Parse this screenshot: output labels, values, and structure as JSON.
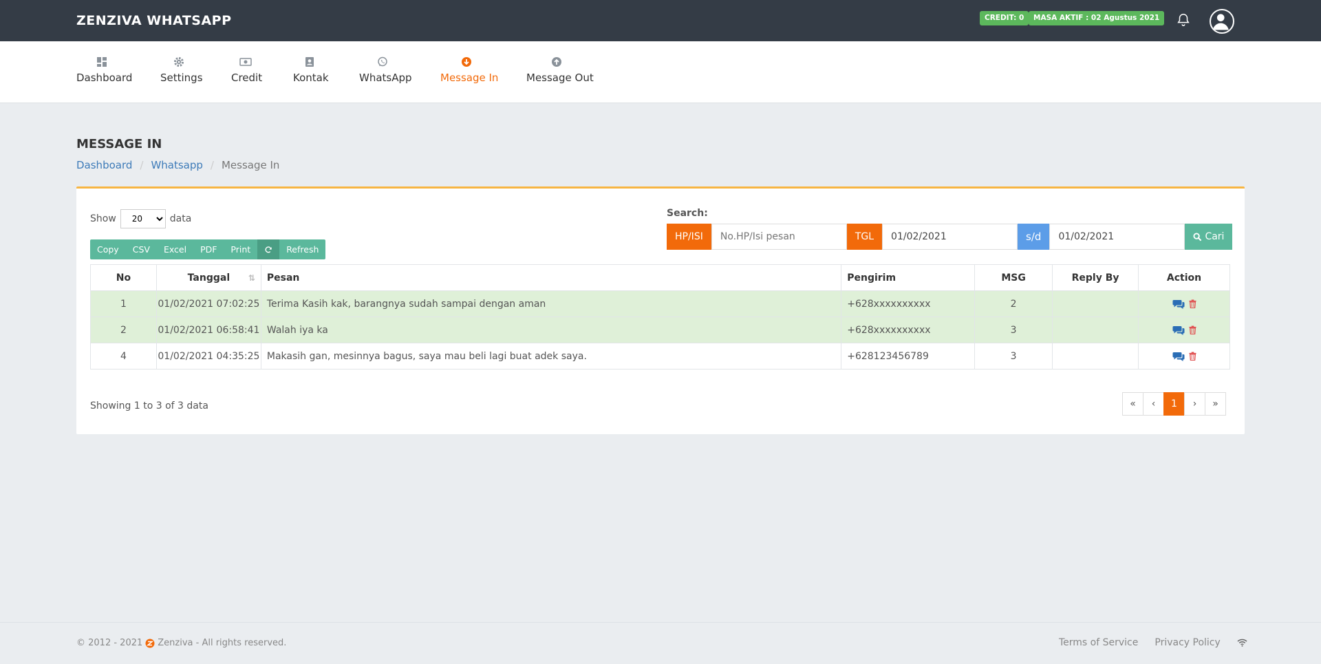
{
  "app": {
    "brand": "ZENZIVA WHATSAPP",
    "credit_badge": "CREDIT: 0",
    "masa_badge": "MASA AKTIF : 02 Agustus 2021"
  },
  "nav": [
    {
      "label": "Dashboard",
      "icon": "dashboard-icon"
    },
    {
      "label": "Settings",
      "icon": "gear-icon"
    },
    {
      "label": "Credit",
      "icon": "money-icon"
    },
    {
      "label": "Kontak",
      "icon": "contact-icon"
    },
    {
      "label": "WhatsApp",
      "icon": "whatsapp-icon"
    },
    {
      "label": "Message In",
      "icon": "arrow-circle-down-icon",
      "active": true
    },
    {
      "label": "Message Out",
      "icon": "arrow-circle-up-icon"
    }
  ],
  "page": {
    "title": "MESSAGE IN",
    "breadcrumb": [
      "Dashboard",
      "Whatsapp",
      "Message In"
    ]
  },
  "controls": {
    "show_label": "Show",
    "show_value": "20",
    "show_suffix": "data",
    "buttons": [
      "Copy",
      "CSV",
      "Excel",
      "PDF",
      "Print"
    ],
    "refresh_label": "Refresh",
    "search_label": "Search:",
    "hp_addon": "HP/ISI",
    "hp_placeholder": "No.HP/Isi pesan",
    "tgl_addon": "TGL",
    "date_from": "01/02/2021",
    "sd_addon": "s/d",
    "date_to": "01/02/2021",
    "cari_label": "Cari"
  },
  "table": {
    "headers": [
      "No",
      "Tanggal",
      "Pesan",
      "Pengirim",
      "MSG",
      "Reply By",
      "Action"
    ],
    "rows": [
      {
        "no": "1",
        "tanggal": "01/02/2021 07:02:25",
        "pesan": "Terima Kasih kak, barangnya sudah sampai dengan aman",
        "pengirim": "+628xxxxxxxxxx",
        "msg": "2",
        "reply_by": ""
      },
      {
        "no": "2",
        "tanggal": "01/02/2021 06:58:41",
        "pesan": "Walah iya ka",
        "pengirim": "+628xxxxxxxxxx",
        "msg": "3",
        "reply_by": ""
      },
      {
        "no": "4",
        "tanggal": "01/02/2021 04:35:25",
        "pesan": "Makasih gan, mesinnya bagus, saya mau beli lagi buat adek saya.",
        "pengirim": "+628123456789",
        "msg": "3",
        "reply_by": ""
      }
    ],
    "info": "Showing 1 to 3 of 3 data"
  },
  "pager": [
    "«",
    "‹",
    "1",
    "›",
    "»"
  ],
  "footer": {
    "copyright": "© 2012 - 2021",
    "company": "Zenziva - All rights reserved.",
    "terms": "Terms of Service",
    "privacy": "Privacy Policy"
  },
  "colors": {
    "accent": "#f26a0a",
    "topbar": "#343c46",
    "success": "#5cb85c",
    "teal": "#5bb89c",
    "row_highlight": "#dff0d8"
  }
}
